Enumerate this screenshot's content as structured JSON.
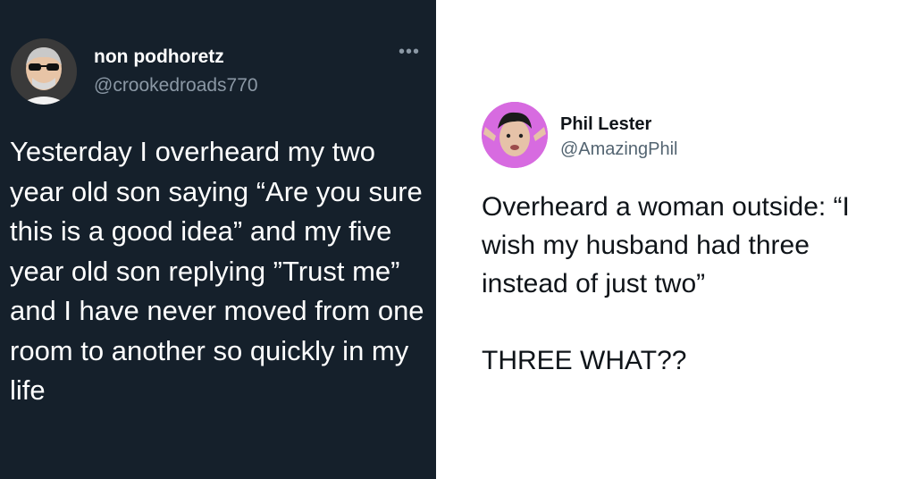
{
  "left_tweet": {
    "display_name": "non podhoretz",
    "handle": "@crookedroads770",
    "more_icon": "more-horizontal-icon",
    "more_glyph": "•••",
    "text": "Yesterday I overheard my two year old son saying “Are you sure this is a good idea” and my five year old son replying ”Trust me” and I have never moved from one room to another so quickly in my life",
    "background": "#15202b"
  },
  "right_tweet": {
    "display_name": "Phil Lester",
    "handle": "@AmazingPhil",
    "text_line1": "Overheard a woman outside: “I wish my husband had three instead of just two”",
    "text_line2": "THREE WHAT??",
    "avatar_background": "#d76be0"
  }
}
